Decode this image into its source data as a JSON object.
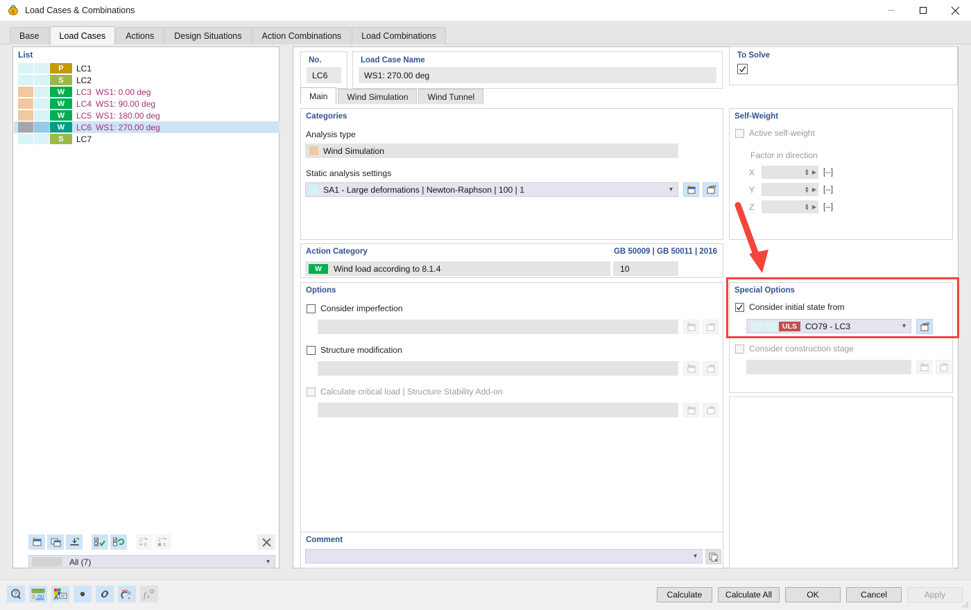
{
  "window": {
    "title": "Load Cases & Combinations",
    "icon": "load-case-icon",
    "minimize": "minimize-icon",
    "maximize": "maximize-icon",
    "close": "close-icon"
  },
  "tabs": [
    {
      "label": "Base",
      "active": false
    },
    {
      "label": "Load Cases",
      "active": true
    },
    {
      "label": "Actions",
      "active": false
    },
    {
      "label": "Design Situations",
      "active": false
    },
    {
      "label": "Action Combinations",
      "active": false
    },
    {
      "label": "Load Combinations",
      "active": false
    }
  ],
  "list": {
    "title": "List",
    "rows": [
      {
        "no": "LC1",
        "name": "",
        "badge": "P",
        "badge_color": "#c39b05",
        "sw1": "#d9f4f7",
        "sw2": "#d9f4f7",
        "selected": false
      },
      {
        "no": "LC2",
        "name": "",
        "badge": "S",
        "badge_color": "#9bb94a",
        "sw1": "#d9f4f7",
        "sw2": "#d9f4f7",
        "selected": false
      },
      {
        "no": "LC3",
        "name": "WS1: 0.00 deg",
        "badge": "W",
        "badge_color": "#00af50",
        "sw1": "#f0c9a0",
        "sw2": "#d9f4f7",
        "selected": false
      },
      {
        "no": "LC4",
        "name": "WS1: 90.00 deg",
        "badge": "W",
        "badge_color": "#00af50",
        "sw1": "#f0c9a0",
        "sw2": "#d9f4f7",
        "selected": false
      },
      {
        "no": "LC5",
        "name": "WS1: 180.00 deg",
        "badge": "W",
        "badge_color": "#00af50",
        "sw1": "#f0c9a0",
        "sw2": "#d9f4f7",
        "selected": false
      },
      {
        "no": "LC6",
        "name": "WS1: 270.00 deg",
        "badge": "W",
        "badge_color": "#009e82",
        "sw1": "#a6a6a6",
        "sw2": "#96c9ea",
        "selected": true
      },
      {
        "no": "LC7",
        "name": "",
        "badge": "S",
        "badge_color": "#9bb94a",
        "sw1": "#d9f4f7",
        "sw2": "#d9f4f7",
        "selected": false
      }
    ],
    "toolbar": [
      {
        "name": "new-load-case-button",
        "enabled": true
      },
      {
        "name": "copy-load-case-button",
        "enabled": true
      },
      {
        "name": "import-load-case-button",
        "enabled": true
      },
      {
        "name": "select-all-button",
        "enabled": true
      },
      {
        "name": "invert-selection-button",
        "enabled": true
      },
      {
        "name": "renumber-button",
        "enabled": false
      },
      {
        "name": "renumber-sequential-button",
        "enabled": false
      }
    ],
    "delete_button": "delete-button",
    "filter_value": "All (7)"
  },
  "detail": {
    "no_label": "No.",
    "no_value": "LC6",
    "name_label": "Load Case Name",
    "name_value": "WS1: 270.00 deg",
    "to_solve_label": "To Solve",
    "to_solve_checked": true,
    "inner_tabs": [
      {
        "label": "Main",
        "active": true
      },
      {
        "label": "Wind Simulation",
        "active": false
      },
      {
        "label": "Wind Tunnel",
        "active": false
      }
    ],
    "categories": {
      "title": "Categories",
      "analysis_type_label": "Analysis type",
      "analysis_type_value": "Wind Simulation",
      "analysis_type_color": "#f0c9a0",
      "static_settings_label": "Static analysis settings",
      "static_settings_value": "SA1 - Large deformations | Newton-Raphson | 100 | 1",
      "static_settings_color": "#d2f3f7",
      "new_button": "new-analysis-settings-button",
      "edit_button": "edit-analysis-settings-button"
    },
    "action_category": {
      "title": "Action Category",
      "standard": "GB 50009 | GB 50011 | 2016",
      "badge": "W",
      "badge_color": "#00af50",
      "value": "Wind load according to 8.1.4",
      "number": "10"
    },
    "options": {
      "title": "Options",
      "items": [
        {
          "label": "Consider imperfection",
          "checked": false,
          "enabled": true,
          "value": "",
          "new_button": "new-imperfection-button",
          "edit_button": "edit-imperfection-button"
        },
        {
          "label": "Structure modification",
          "checked": false,
          "enabled": true,
          "value": "",
          "new_button": "new-structure-modification-button",
          "edit_button": "edit-structure-modification-button"
        },
        {
          "label": "Calculate critical load | Structure Stability Add-on",
          "checked": false,
          "enabled": false,
          "value": "",
          "new_button": "new-stability-button",
          "edit_button": "edit-stability-button"
        }
      ]
    },
    "comment": {
      "title": "Comment",
      "value": "",
      "copy_button": "comment-library-button"
    }
  },
  "right": {
    "self_weight": {
      "title": "Self-Weight",
      "active_label": "Active self-weight",
      "active_checked": false,
      "factor_label": "Factor in direction",
      "axes": [
        {
          "axis": "X",
          "value": "",
          "unit": "[--]"
        },
        {
          "axis": "Y",
          "value": "",
          "unit": "[--]"
        },
        {
          "axis": "Z",
          "value": "",
          "unit": "[--]"
        }
      ]
    },
    "special_options": {
      "title": "Special Options",
      "initial_state_label": "Consider initial state from",
      "initial_state_checked": true,
      "initial_state_badge": "ULS",
      "initial_state_badge_color": "#c0504d",
      "initial_state_value": "CO79 - LC3",
      "initial_state_edit_button": "edit-initial-state-button",
      "construction_stage_label": "Consider construction stage",
      "construction_stage_checked": false,
      "construction_stage_enabled": false,
      "construction_new_button": "new-construction-stage-button",
      "construction_edit_button": "edit-construction-stage-button"
    }
  },
  "annotation": {
    "highlight_color": "#f4443c",
    "arrow": "red-arrow-pointing-to-special-options"
  },
  "footer": {
    "icons": [
      {
        "name": "info-icon",
        "enabled": true
      },
      {
        "name": "units-icon",
        "enabled": true
      },
      {
        "name": "display-properties-icon",
        "enabled": true
      },
      {
        "name": "dot-icon",
        "enabled": true
      },
      {
        "name": "link-icon",
        "enabled": true
      },
      {
        "name": "snap-icon",
        "enabled": true
      },
      {
        "name": "formula-icon",
        "enabled": false
      }
    ],
    "buttons": [
      {
        "label": "Calculate",
        "enabled": true
      },
      {
        "label": "Calculate All",
        "enabled": true
      },
      {
        "label": "OK",
        "enabled": true
      },
      {
        "label": "Cancel",
        "enabled": true
      },
      {
        "label": "Apply",
        "enabled": false
      }
    ]
  }
}
